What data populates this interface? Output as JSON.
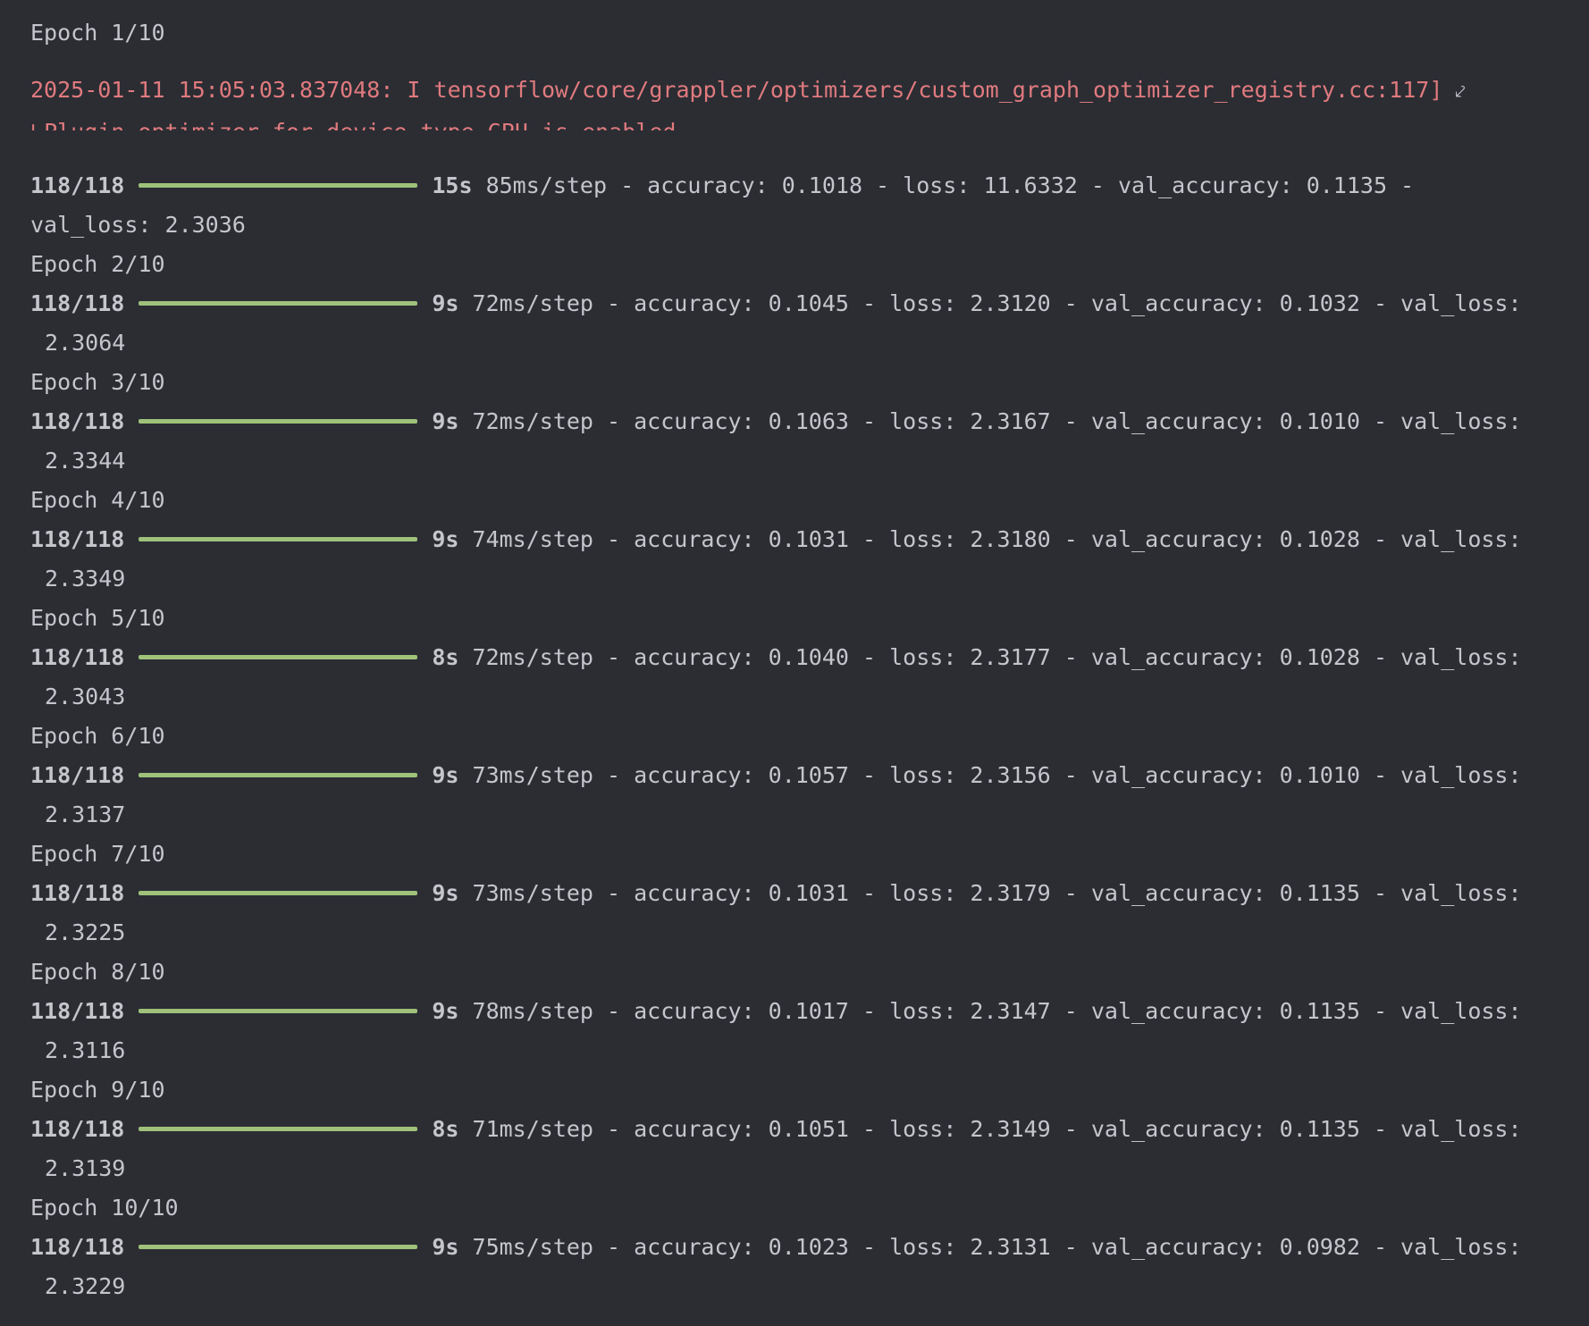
{
  "first_epoch_label": "Epoch 1/10",
  "warning": {
    "line1": "2025-01-11 15:05:03.837048: I tensorflow/core/grappler/optimizers/custom_graph_optimizer_registry.cc:117]",
    "line2": "Plugin optimizer for device type GPU is enabled.",
    "wrap_icon": "soft-wrap-icon"
  },
  "colors": {
    "background": "#2b2d33",
    "text": "#c4c6cc",
    "warning": "#e07a7e",
    "progress_bar": "#9fc17a"
  },
  "epochs": [
    {
      "label": "Epoch 1/10",
      "steps": "118/118",
      "time": "15s",
      "rest": " 85ms/step - accuracy: 0.1018 - loss: 11.6332 - val_accuracy: 0.1135 -",
      "cont": "val_loss: 2.3036"
    },
    {
      "label": "Epoch 2/10",
      "steps": "118/118",
      "time": "9s",
      "rest": " 72ms/step - accuracy: 0.1045 - loss: 2.3120 - val_accuracy: 0.1032 - val_loss:",
      "cont": "2.3064"
    },
    {
      "label": "Epoch 3/10",
      "steps": "118/118",
      "time": "9s",
      "rest": " 72ms/step - accuracy: 0.1063 - loss: 2.3167 - val_accuracy: 0.1010 - val_loss:",
      "cont": "2.3344"
    },
    {
      "label": "Epoch 4/10",
      "steps": "118/118",
      "time": "9s",
      "rest": " 74ms/step - accuracy: 0.1031 - loss: 2.3180 - val_accuracy: 0.1028 - val_loss:",
      "cont": "2.3349"
    },
    {
      "label": "Epoch 5/10",
      "steps": "118/118",
      "time": "8s",
      "rest": " 72ms/step - accuracy: 0.1040 - loss: 2.3177 - val_accuracy: 0.1028 - val_loss:",
      "cont": "2.3043"
    },
    {
      "label": "Epoch 6/10",
      "steps": "118/118",
      "time": "9s",
      "rest": " 73ms/step - accuracy: 0.1057 - loss: 2.3156 - val_accuracy: 0.1010 - val_loss:",
      "cont": "2.3137"
    },
    {
      "label": "Epoch 7/10",
      "steps": "118/118",
      "time": "9s",
      "rest": " 73ms/step - accuracy: 0.1031 - loss: 2.3179 - val_accuracy: 0.1135 - val_loss:",
      "cont": "2.3225"
    },
    {
      "label": "Epoch 8/10",
      "steps": "118/118",
      "time": "9s",
      "rest": " 78ms/step - accuracy: 0.1017 - loss: 2.3147 - val_accuracy: 0.1135 - val_loss:",
      "cont": "2.3116"
    },
    {
      "label": "Epoch 9/10",
      "steps": "118/118",
      "time": "8s",
      "rest": " 71ms/step - accuracy: 0.1051 - loss: 2.3149 - val_accuracy: 0.1135 - val_loss:",
      "cont": "2.3139"
    },
    {
      "label": "Epoch 10/10",
      "steps": "118/118",
      "time": "9s",
      "rest": " 75ms/step - accuracy: 0.1023 - loss: 2.3131 - val_accuracy: 0.0982 - val_loss:",
      "cont": "2.3229"
    }
  ]
}
